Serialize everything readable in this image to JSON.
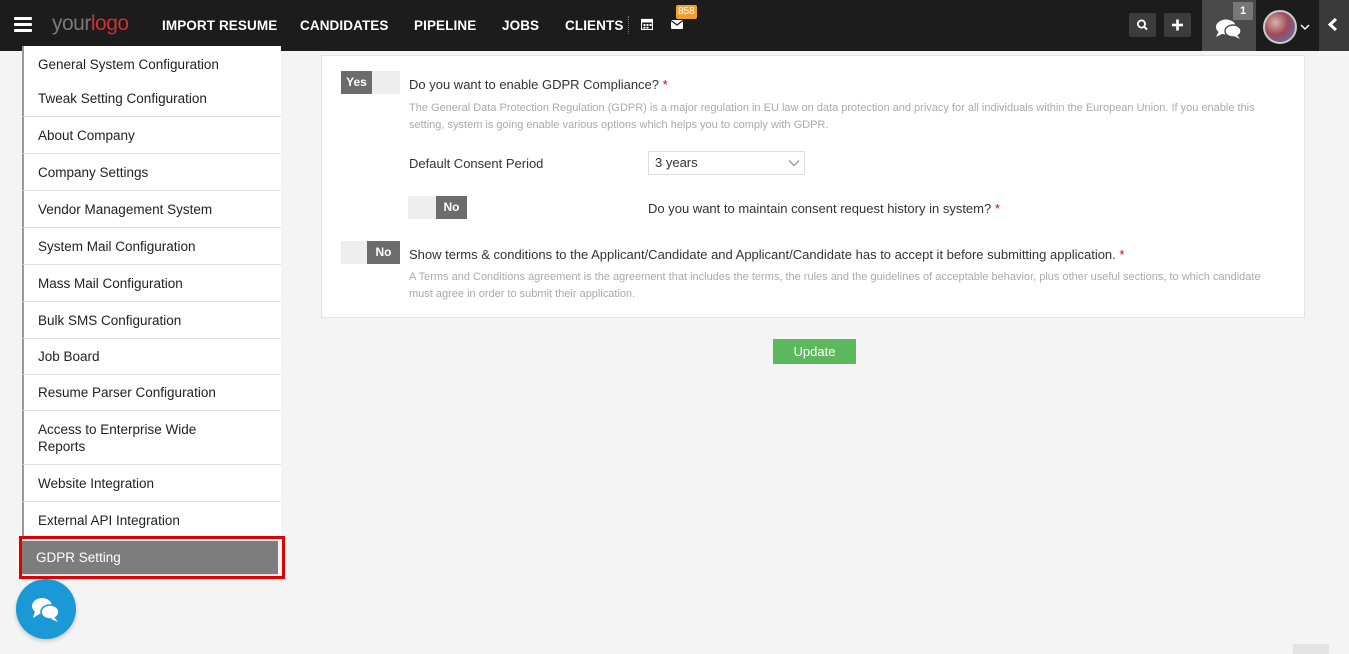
{
  "logo": {
    "part1": "your",
    "part2": "logo"
  },
  "nav": {
    "items": [
      "IMPORT RESUME",
      "CANDIDATES",
      "PIPELINE",
      "JOBS",
      "CLIENTS"
    ],
    "mail_badge": "858",
    "chat_badge": "1"
  },
  "sidebar": {
    "items": [
      "General System Configuration",
      "Tweak Setting Configuration",
      "About Company",
      "Company Settings",
      "Vendor Management System",
      "System Mail Configuration",
      "Mass Mail Configuration",
      "Bulk SMS Configuration",
      "Job Board",
      "Resume Parser Configuration",
      "Access to Enterprise Wide Reports",
      "Website Integration",
      "External API Integration",
      "GDPR Setting"
    ],
    "active_index": 13
  },
  "gdpr": {
    "enable_toggle": "Yes",
    "enable_question": "Do you want to enable GDPR Compliance?",
    "enable_help": "The General Data Protection Regulation (GDPR) is a major regulation in EU law on data protection and privacy for all individuals within the European Union. If you enable this setting, system is going enable various options which helps you to comply with GDPR.",
    "consent_period_label": "Default Consent Period",
    "consent_period_value": "3 years",
    "history_toggle": "No",
    "history_question": "Do you want to maintain consent request history in system?",
    "terms_toggle": "No",
    "terms_question": "Show terms & conditions to the Applicant/Candidate and Applicant/Candidate has to accept it before submitting application.",
    "terms_help": "A Terms and Conditions agreement is the agreement that includes the terms, the rules and the guidelines of acceptable behavior, plus other useful sections, to which candidate must agree in order to submit their application.",
    "required_mark": "*"
  },
  "actions": {
    "update_label": "Update"
  },
  "colors": {
    "topbar": "#1c1c1c",
    "accent_red": "#d0312d",
    "update_green": "#5cb85c",
    "badge_orange": "#f0a030",
    "chat_blue": "#1b98d6"
  }
}
